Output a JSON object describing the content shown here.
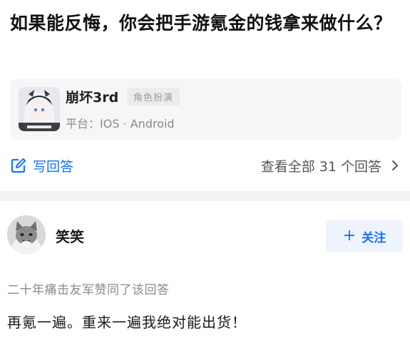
{
  "question": {
    "title": "如果能反悔，你会把手游氪金的钱拿来做什么？"
  },
  "topic": {
    "game_name": "崩坏3rd",
    "tag": "角色扮演",
    "platform": "平台：IOS · Android",
    "icon": "game-cover-icon"
  },
  "actions": {
    "write_answer_label": "写回答",
    "write_icon": "pen-square-icon",
    "view_all_label": "查看全部 31 个回答",
    "chevron_icon": "chevron-right-icon"
  },
  "answer": {
    "author_name": "笑笑",
    "follow_label": "关注",
    "follow_icon": "plus-icon",
    "upvote_note": "二十年痛击友军赞同了该回答",
    "content": "再氪一遍。重来一遍我绝对能出货！"
  },
  "colors": {
    "accent": "#1772f6",
    "follow_bg": "#eef4fe",
    "card_bg": "#f6f6f6",
    "secondary_text": "#8a8a8a"
  }
}
